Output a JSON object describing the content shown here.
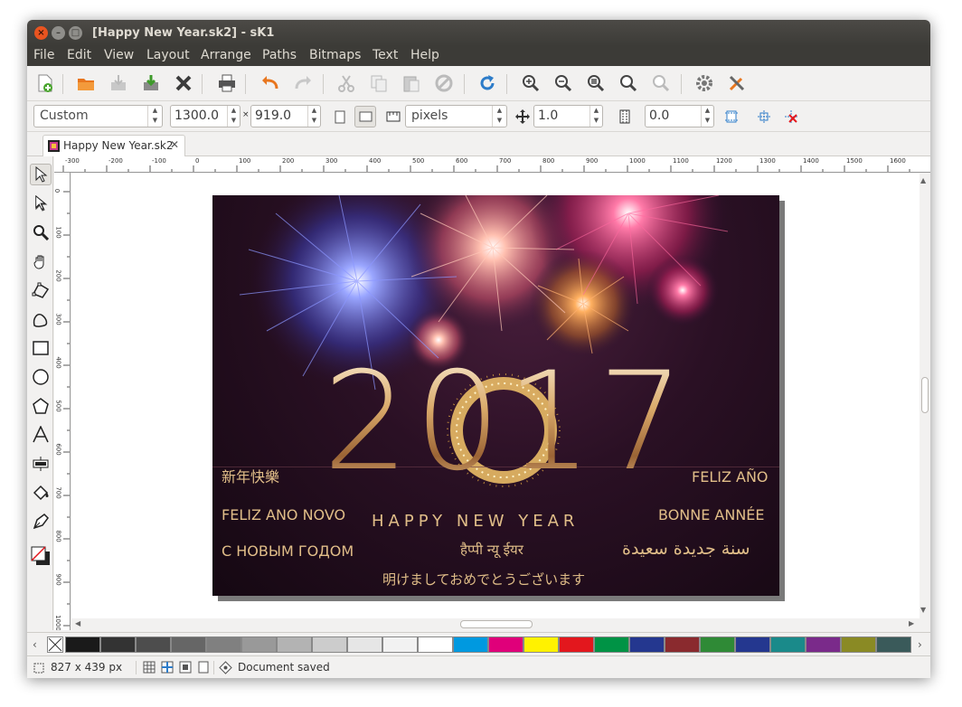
{
  "window": {
    "title": "[Happy New Year.sk2] - sK1"
  },
  "menu": [
    "File",
    "Edit",
    "View",
    "Layout",
    "Arrange",
    "Paths",
    "Bitmaps",
    "Text",
    "Help"
  ],
  "toolbar": [
    "new-document",
    "open",
    "save",
    "import",
    "close",
    "print",
    "undo",
    "redo",
    "cut",
    "copy",
    "paste",
    "delete",
    "refresh",
    "zoom-in",
    "zoom-out",
    "zoom-fit",
    "zoom-selection",
    "zoom-page",
    "preferences",
    "tools"
  ],
  "properties": {
    "page_format": "Custom",
    "width": "1300.0",
    "times": "×",
    "height": "919.0",
    "units": "pixels",
    "step": "1.0",
    "margin": "0.0"
  },
  "tab": {
    "label": "Happy New Year.sk2"
  },
  "ruler": {
    "h": [
      "-300",
      "-200",
      "-100",
      "0",
      "100",
      "200",
      "300",
      "400",
      "500",
      "600",
      "700",
      "800",
      "900",
      "1000",
      "1100",
      "1200",
      "1300",
      "1400",
      "1500",
      "1600"
    ],
    "v": [
      "0",
      "100",
      "200",
      "300",
      "400",
      "500",
      "600",
      "700",
      "800",
      "900",
      "1000"
    ]
  },
  "card": {
    "year": "2017",
    "greetings": {
      "chinese": "新年快樂",
      "portuguese": "FELIZ ANO NOVO",
      "russian": "С НОВЫМ ГОДОМ",
      "english": "HAPPY NEW YEAR",
      "hindi": "हैप्पी न्यू ईयर",
      "japanese": "明けましておめでとうございます",
      "spanish": "FELIZ AÑO",
      "french": "BONNE ANNÉE",
      "arabic": "سنة جديدة سعيدة"
    }
  },
  "palette": [
    "#ffffff",
    "#1a1a1a",
    "#333333",
    "#4d4d4d",
    "#666666",
    "#808080",
    "#999999",
    "#b3b3b3",
    "#cccccc",
    "#e6e6e6",
    "#f2f2f2",
    "#ffffff",
    "#0099e0",
    "#e0007a",
    "#fff200",
    "#e3171d",
    "#009345",
    "#24378f",
    "#8a2a2e",
    "#2f8a36",
    "#24378f",
    "#1a8a8a",
    "#7a2a8a",
    "#8a8a24",
    "#3a5a5a"
  ],
  "status": {
    "size": "827 x 439 px",
    "message": "Document saved"
  }
}
